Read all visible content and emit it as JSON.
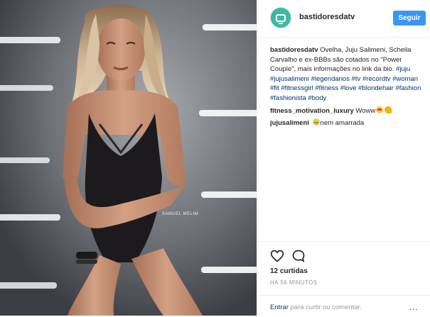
{
  "header": {
    "username": "bastidoresdatv",
    "follow_label": "Seguir"
  },
  "photo": {
    "watermark": "SAMUEL MELIM",
    "alt": "photo"
  },
  "caption": {
    "username": "bastidoresdatv",
    "text": "Ovelha, Juju Salimeni, Scheila Carvalho e ex-BBBs são cotados no \"Power Couple\", mais informações no link da bio.",
    "hashtags": [
      "#juju",
      "#jujusalimeni",
      "#legendarios",
      "#tv",
      "#recordtv",
      "#woman",
      "#fit",
      "#fitnessgirl",
      "#fitness",
      "#love",
      "#blondehair",
      "#fashion",
      "#fashionista",
      "#body"
    ]
  },
  "comments": [
    {
      "username": "fitness_motivation_luxury",
      "text": "Woww"
    },
    {
      "username": "jujusalimeni",
      "text": "nem amarrada"
    }
  ],
  "actions": {
    "likes": "12 curtidas",
    "timestamp": "HÁ 56 MINUTOS",
    "login_link": "Entrar",
    "login_rest": "para curtir ou comentar.",
    "more_label": "..."
  },
  "icons": {
    "like": "heart-icon",
    "comment": "comment-icon",
    "more": "more-icon"
  },
  "colors": {
    "accent": "#3897f0",
    "hashtag": "#003569",
    "avatar": "#3cb8a6"
  }
}
